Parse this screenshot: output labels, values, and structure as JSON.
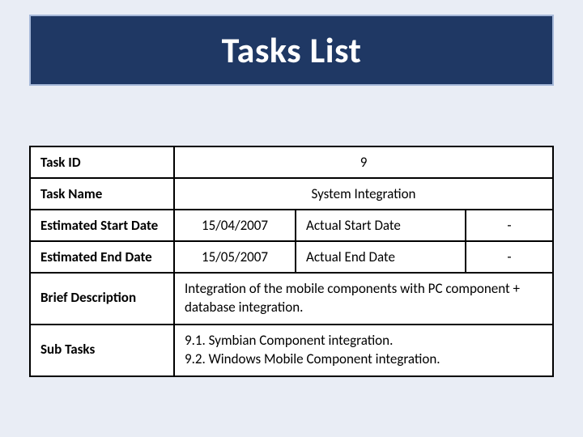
{
  "title": "Tasks List",
  "rows": {
    "task_id_label": "Task ID",
    "task_id_value": "9",
    "task_name_label": "Task Name",
    "task_name_value": "System Integration",
    "est_start_label": "Estimated Start Date",
    "est_start_value": "15/04/2007",
    "actual_start_label": "Actual Start Date",
    "actual_start_value": "-",
    "est_end_label": "Estimated End Date",
    "est_end_value": "15/05/2007",
    "actual_end_label": "Actual End Date",
    "actual_end_value": "-",
    "brief_label": "Brief Description",
    "brief_value": "Integration of the mobile components with PC component + database integration.",
    "subtasks_label": "Sub Tasks",
    "subtasks_value": "9.1. Symbian Component integration.\n9.2. Windows Mobile Component integration."
  }
}
